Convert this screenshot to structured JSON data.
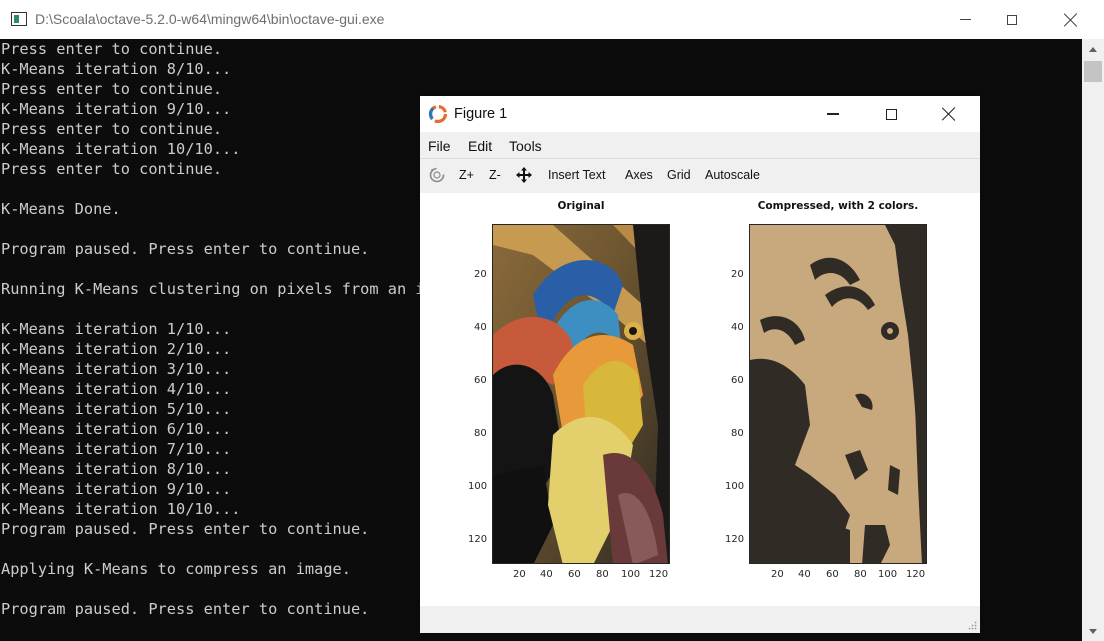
{
  "console_window": {
    "title": "D:\\Scoala\\octave-5.2.0-w64\\mingw64\\bin\\octave-gui.exe",
    "lines": [
      "Press enter to continue.",
      "K-Means iteration 8/10...",
      "Press enter to continue.",
      "K-Means iteration 9/10...",
      "Press enter to continue.",
      "K-Means iteration 10/10...",
      "Press enter to continue.",
      "",
      "K-Means Done.",
      "",
      "Program paused. Press enter to continue.",
      "",
      "Running K-Means clustering on pixels from an image.",
      "",
      "K-Means iteration 1/10...",
      "K-Means iteration 2/10...",
      "K-Means iteration 3/10...",
      "K-Means iteration 4/10...",
      "K-Means iteration 5/10...",
      "K-Means iteration 6/10...",
      "K-Means iteration 7/10...",
      "K-Means iteration 8/10...",
      "K-Means iteration 9/10...",
      "K-Means iteration 10/10...",
      "Program paused. Press enter to continue.",
      "",
      "Applying K-Means to compress an image.",
      "",
      "Program paused. Press enter to continue."
    ],
    "colors": {
      "background": "#0c0c0c",
      "text": "#cccccc"
    }
  },
  "figure_window": {
    "title": "Figure 1",
    "menu": [
      "File",
      "Edit",
      "Tools"
    ],
    "toolbar": {
      "rotate_icon": "rotate-3d-icon",
      "zoom_in": "Z+",
      "zoom_out": "Z-",
      "pan_icon": "pan-move-icon",
      "insert_text": "Insert Text",
      "axes": "Axes",
      "grid": "Grid",
      "autoscale": "Autoscale"
    },
    "plots": [
      {
        "title": "Original",
        "content": "photograph of a bird (hornbill) head",
        "xticks": [
          "20",
          "40",
          "60",
          "80",
          "100",
          "120"
        ],
        "yticks": [
          "20",
          "40",
          "60",
          "80",
          "100",
          "120"
        ]
      },
      {
        "title": "Compressed, with 2 colors.",
        "content": "two-color compressed bird image",
        "palette": [
          "#c8a97e",
          "#312b25"
        ],
        "xticks": [
          "20",
          "40",
          "60",
          "80",
          "100",
          "120"
        ],
        "yticks": [
          "20",
          "40",
          "60",
          "80",
          "100",
          "120"
        ]
      }
    ]
  }
}
